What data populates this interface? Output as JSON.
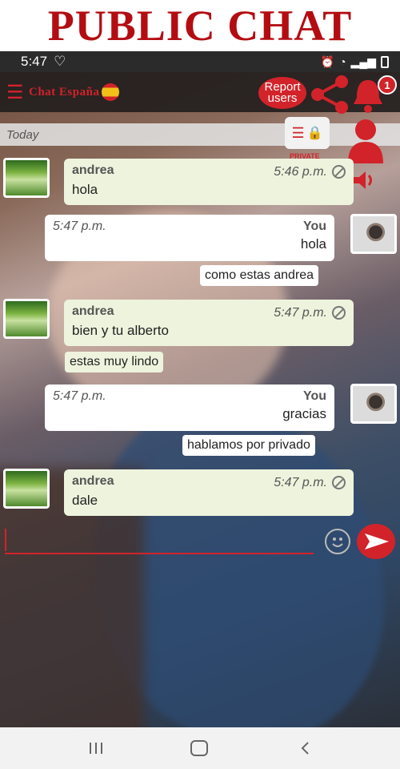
{
  "banner": {
    "title": "PUBLIC CHAT"
  },
  "status": {
    "time": "5:47",
    "heart": "♡"
  },
  "toolbar": {
    "menu_icon": "☰",
    "app_title": "Chat España",
    "report_label": "Report users",
    "notification_count": "1"
  },
  "private": {
    "label": "PRIVATE"
  },
  "today": {
    "label": "Today"
  },
  "messages": [
    {
      "name": "andrea",
      "time": "5:46 p.m.",
      "text": "hola"
    },
    {
      "name": "You",
      "time": "5:47 p.m.",
      "text": "hola"
    },
    {
      "text": "como estas andrea"
    },
    {
      "name": "andrea",
      "time": "5:47 p.m.",
      "text": "bien y tu alberto"
    },
    {
      "text": "estas muy lindo"
    },
    {
      "name": "You",
      "time": "5:47 p.m.",
      "text": "gracias"
    },
    {
      "text": "hablamos por privado"
    },
    {
      "name": "andrea",
      "time": "5:47 p.m.",
      "text": "dale"
    }
  ],
  "input": {
    "value": ""
  },
  "colors": {
    "accent": "#d2232a",
    "incoming_bubble": "#eef3dd",
    "outgoing_bubble": "#ffffff"
  }
}
